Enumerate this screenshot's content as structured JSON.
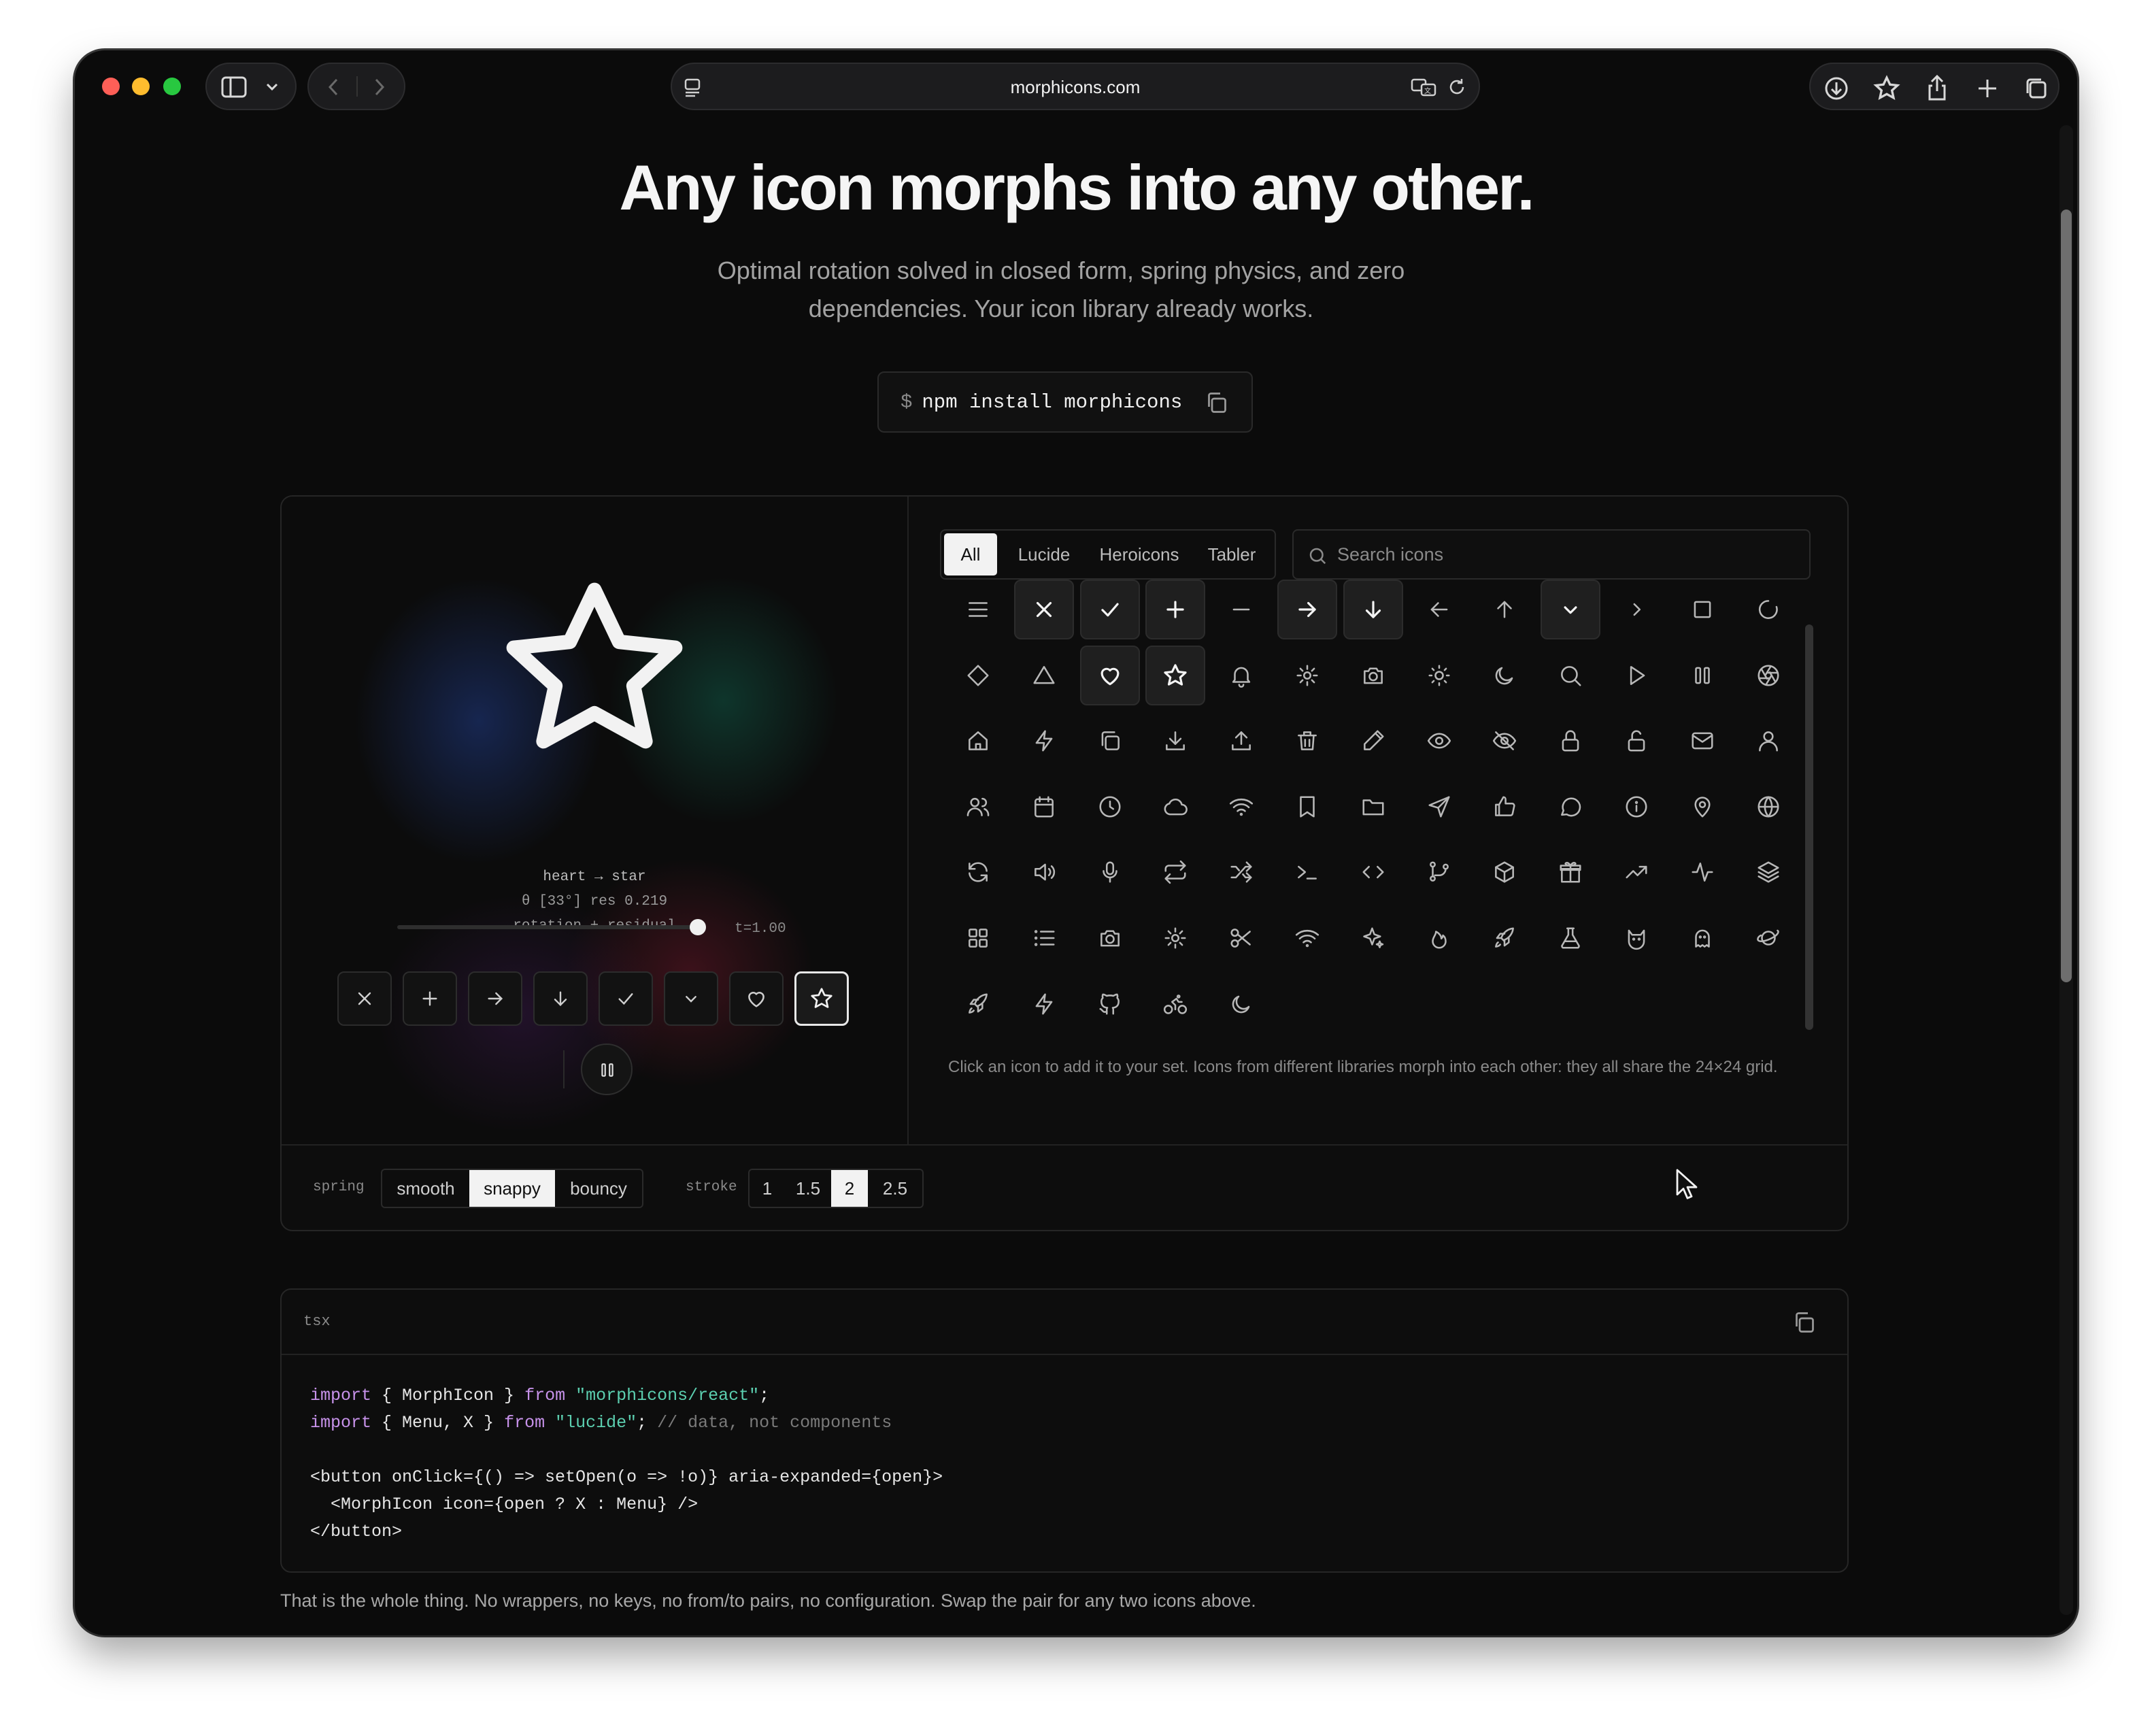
{
  "browser": {
    "url": "morphicons.com"
  },
  "hero": {
    "title": "Any icon morphs into any other.",
    "subtitle_line1": "Optimal rotation solved in closed form, spring physics, and zero",
    "subtitle_line2": "dependencies. Your icon library already works.",
    "install_prompt": "$",
    "install_command": "npm install morphicons"
  },
  "stage": {
    "morph_label": "heart → star",
    "theta_label": "θ [33°] res 0.219",
    "method_label": "rotation + residual",
    "slider_label": "t=1.00",
    "slider_progress": 1.0,
    "current_icon": "star-icon",
    "chips": [
      "x-icon",
      "plus-icon",
      "arrow-right-icon",
      "arrow-down-icon",
      "check-icon",
      "chevron-down-icon",
      "heart-icon",
      "star-icon"
    ],
    "active_chip": "star-icon"
  },
  "library": {
    "tabs": [
      "All",
      "Lucide",
      "Heroicons",
      "Tabler"
    ],
    "active_tab": "All",
    "search_placeholder": "Search icons",
    "hint": "Click an icon to add it to your set. Icons from different libraries morph into each other: they all share the 24×24 grid."
  },
  "controls": {
    "spring_label": "spring",
    "spring_options": [
      "smooth",
      "snappy",
      "bouncy"
    ],
    "spring_active": "snappy",
    "stroke_label": "stroke",
    "stroke_options": [
      "1",
      "1.5",
      "2",
      "2.5"
    ],
    "stroke_active": "2"
  },
  "code": {
    "lang": "tsx"
  },
  "footer": {
    "text": "That is the whole thing. No wrappers, no keys, no from/to pairs, no configuration. Swap the pair for any two icons above."
  },
  "colors": {
    "background": "#0b0b0b",
    "accent_keyword": "#c792ea",
    "accent_string": "#5ccfb0"
  }
}
